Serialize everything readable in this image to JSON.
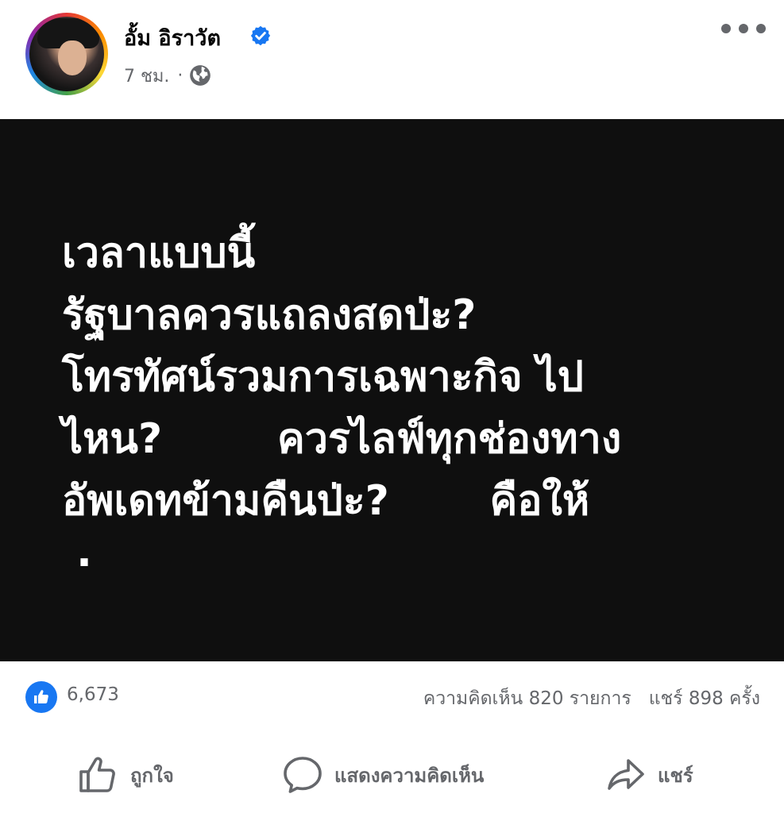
{
  "post": {
    "author": {
      "name": "อั้ม อิราวัต",
      "verified": true
    },
    "timestamp": "7 ชม.",
    "meta_separator": "·",
    "privacy_icon": "globe-icon",
    "menu_icon": "more-horizontal-icon",
    "image_text": "เวลาแบบนี้\nรัฐบาลควรแถลงสดป่ะ?\nโทรทัศน์รวมการเฉพาะกิจ ไป\nไหน?        ควรไลฟ์ทุกช่องทาง\nอัพเดทข้ามคืนป่ะ?       คือให้\n ·",
    "image_background": "#0f0f0f"
  },
  "reactions": {
    "icon": "like-icon",
    "count": "6,673"
  },
  "stats": {
    "comments": "ความคิดเห็น 820 รายการ",
    "shares": "แชร์ 898 ครั้ง"
  },
  "actions": {
    "like_label": "ถูกใจ",
    "comment_label": "แสดงความคิดเห็น",
    "share_label": "แชร์"
  },
  "colors": {
    "accent": "#1877f2",
    "secondary_text": "#65676b",
    "primary_text": "#050505"
  }
}
